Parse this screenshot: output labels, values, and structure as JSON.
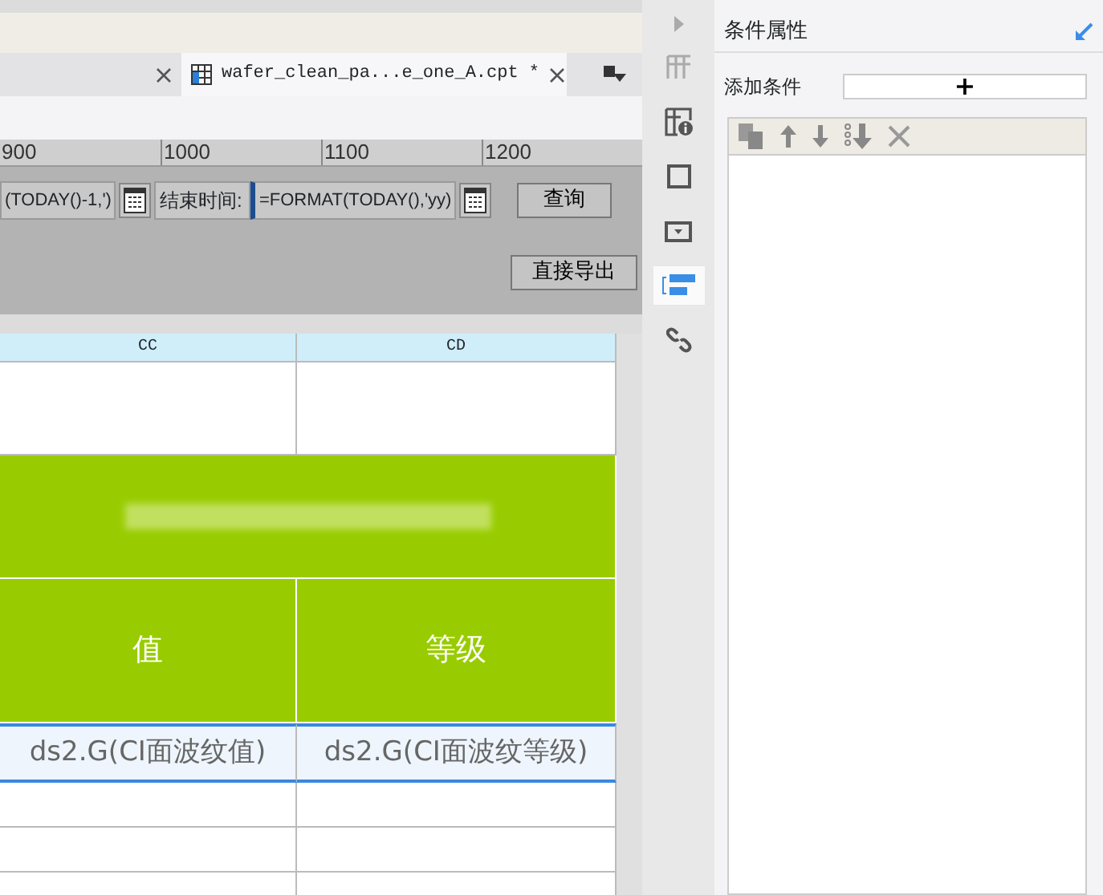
{
  "tabs": [
    {
      "selected": false
    },
    {
      "label": "wafer_clean_pa...e_one_A.cpt *",
      "selected": true
    }
  ],
  "ruler": [
    "900",
    "1000",
    "1100",
    "1200"
  ],
  "parameters": {
    "start_value": "(TODAY()-1,')",
    "end_label": "结束时间:",
    "end_value": "=FORMAT(TODAY(),'yy)",
    "query_button": "查询",
    "export_button": "直接导出"
  },
  "sheet": {
    "columns": [
      "CC",
      "CD"
    ],
    "header_cells": [
      "值",
      "等级"
    ],
    "formula_cells": [
      {
        "text": "ds2.G(CI面波纹值)",
        "selected": true
      },
      {
        "text": "ds2.G(CI面波纹等级)",
        "selected": true
      }
    ]
  },
  "side_icons": [
    {
      "kind": "grid",
      "selected": false
    },
    {
      "kind": "info",
      "selected": false
    },
    {
      "kind": "frame",
      "selected": false
    },
    {
      "kind": "dropdown",
      "selected": false
    },
    {
      "kind": "condition",
      "selected": true
    },
    {
      "kind": "link",
      "selected": false
    }
  ],
  "panel": {
    "title": "条件属性",
    "add_label": "添加条件",
    "add_button": "+"
  }
}
